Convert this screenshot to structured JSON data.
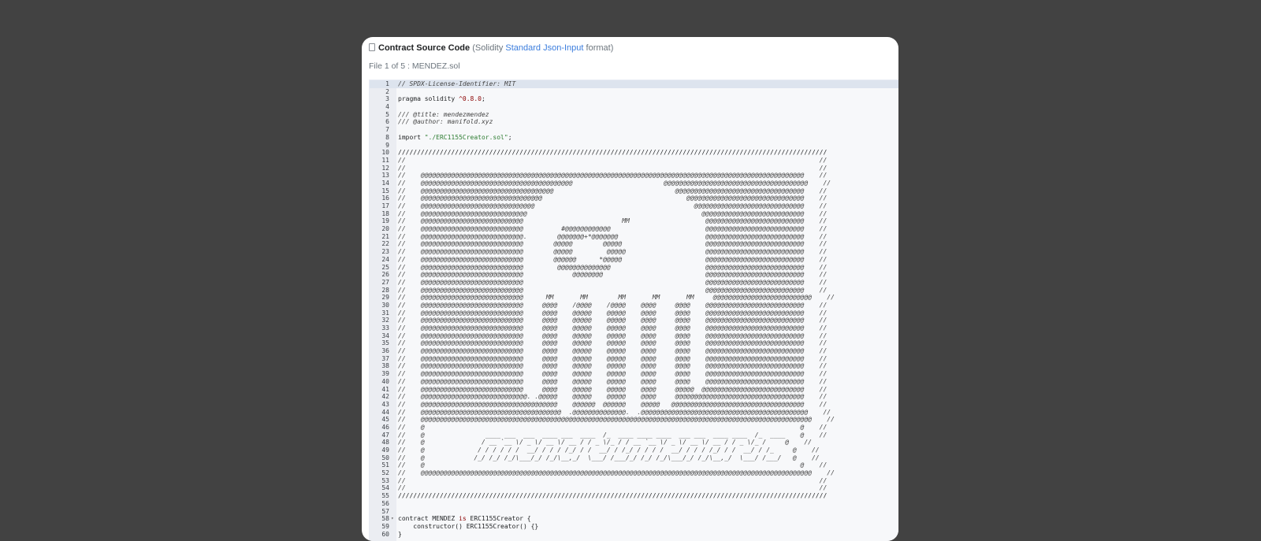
{
  "header": {
    "title": "Contract Source Code",
    "format_open": "(Solidity",
    "format_link": "Standard Json-Input",
    "format_close": "format)"
  },
  "file_info": "File 1 of 5 : MENDEZ.sol",
  "code": {
    "lines": [
      "// SPDX-License-Identifier: MIT",
      "",
      "pragma solidity ^0.8.0;",
      "",
      "/// @title: mendezmendez",
      "/// @author: manifold.xyz",
      "",
      "import \"./ERC1155Creator.sol\";",
      "",
      "/////////////////////////////////////////////////////////////////////////////////////////////////////////////////",
      "//                                                                                                             //",
      "//                                                                                                             //",
      "//    @@@@@@@@@@@@@@@@@@@@@@@@@@@@@@@@@@@@@@@@@@@@@@@@@@@@@@@@@@@@@@@@@@@@@@@@@@@@@@@@@@@@@@@@@@@@@@@@@@@@@    //",
      "//    @@@@@@@@@@@@@@@@@@@@@@@@@@@@@@@@@@@@@@@@                        @@@@@@@@@@@@@@@@@@@@@@@@@@@@@@@@@@@@@@    //",
      "//    @@@@@@@@@@@@@@@@@@@@@@@@@@@@@@@@@@@                                @@@@@@@@@@@@@@@@@@@@@@@@@@@@@@@@@@    //",
      "//    @@@@@@@@@@@@@@@@@@@@@@@@@@@@@@@@                                      @@@@@@@@@@@@@@@@@@@@@@@@@@@@@@@    //",
      "//    @@@@@@@@@@@@@@@@@@@@@@@@@@@@@@                                          @@@@@@@@@@@@@@@@@@@@@@@@@@@@@    //",
      "//    @@@@@@@@@@@@@@@@@@@@@@@@@@@@                                              @@@@@@@@@@@@@@@@@@@@@@@@@@@    //",
      "//    @@@@@@@@@@@@@@@@@@@@@@@@@@@                          MM                    @@@@@@@@@@@@@@@@@@@@@@@@@@    //",
      "//    @@@@@@@@@@@@@@@@@@@@@@@@@@@          #@@@@@@@@@@@@                         @@@@@@@@@@@@@@@@@@@@@@@@@@    //",
      "//    @@@@@@@@@@@@@@@@@@@@@@@@@@@.        @@@@@@@+*@@@@@@@                       @@@@@@@@@@@@@@@@@@@@@@@@@@    //",
      "//    @@@@@@@@@@@@@@@@@@@@@@@@@@@        @@@@@        @@@@@                      @@@@@@@@@@@@@@@@@@@@@@@@@@    //",
      "//    @@@@@@@@@@@@@@@@@@@@@@@@@@@        @@@@@         @@@@@                     @@@@@@@@@@@@@@@@@@@@@@@@@@    //",
      "//    @@@@@@@@@@@@@@@@@@@@@@@@@@@        @@@@@@      *@@@@@                      @@@@@@@@@@@@@@@@@@@@@@@@@@    //",
      "//    @@@@@@@@@@@@@@@@@@@@@@@@@@@         @@@@@@@@@@@@@@                         @@@@@@@@@@@@@@@@@@@@@@@@@@    //",
      "//    @@@@@@@@@@@@@@@@@@@@@@@@@@@             @@@@@@@@                           @@@@@@@@@@@@@@@@@@@@@@@@@@    //",
      "//    @@@@@@@@@@@@@@@@@@@@@@@@@@@                                                @@@@@@@@@@@@@@@@@@@@@@@@@@    //",
      "//    @@@@@@@@@@@@@@@@@@@@@@@@@@@                                                @@@@@@@@@@@@@@@@@@@@@@@@@@    //",
      "//    @@@@@@@@@@@@@@@@@@@@@@@@@@@      MM       MM        MM       MM       MM     @@@@@@@@@@@@@@@@@@@@@@@@@@    //",
      "//    @@@@@@@@@@@@@@@@@@@@@@@@@@@     @@@@    /@@@@    /@@@@    @@@@     @@@@    @@@@@@@@@@@@@@@@@@@@@@@@@@    //",
      "//    @@@@@@@@@@@@@@@@@@@@@@@@@@@     @@@@    @@@@@    @@@@@    @@@@     @@@@    @@@@@@@@@@@@@@@@@@@@@@@@@@    //",
      "//    @@@@@@@@@@@@@@@@@@@@@@@@@@@     @@@@    @@@@@    @@@@@    @@@@     @@@@    @@@@@@@@@@@@@@@@@@@@@@@@@@    //",
      "//    @@@@@@@@@@@@@@@@@@@@@@@@@@@     @@@@    @@@@@    @@@@@    @@@@     @@@@    @@@@@@@@@@@@@@@@@@@@@@@@@@    //",
      "//    @@@@@@@@@@@@@@@@@@@@@@@@@@@     @@@@    @@@@@    @@@@@    @@@@     @@@@    @@@@@@@@@@@@@@@@@@@@@@@@@@    //",
      "//    @@@@@@@@@@@@@@@@@@@@@@@@@@@     @@@@    @@@@@    @@@@@    @@@@     @@@@    @@@@@@@@@@@@@@@@@@@@@@@@@@    //",
      "//    @@@@@@@@@@@@@@@@@@@@@@@@@@@     @@@@    @@@@@    @@@@@    @@@@     @@@@    @@@@@@@@@@@@@@@@@@@@@@@@@@    //",
      "//    @@@@@@@@@@@@@@@@@@@@@@@@@@@     @@@@    @@@@@    @@@@@    @@@@     @@@@    @@@@@@@@@@@@@@@@@@@@@@@@@@    //",
      "//    @@@@@@@@@@@@@@@@@@@@@@@@@@@     @@@@    @@@@@    @@@@@    @@@@     @@@@    @@@@@@@@@@@@@@@@@@@@@@@@@@    //",
      "//    @@@@@@@@@@@@@@@@@@@@@@@@@@@     @@@@    @@@@@    @@@@@    @@@@     @@@@    @@@@@@@@@@@@@@@@@@@@@@@@@@    //",
      "//    @@@@@@@@@@@@@@@@@@@@@@@@@@@     @@@@    @@@@@    @@@@@    @@@@     @@@@    @@@@@@@@@@@@@@@@@@@@@@@@@@    //",
      "//    @@@@@@@@@@@@@@@@@@@@@@@@@@@     @@@@    @@@@@    @@@@@    @@@@     @@@@@  @@@@@@@@@@@@@@@@@@@@@@@@@@@    //",
      "//    @@@@@@@@@@@@@@@@@@@@@@@@@@@@. .@@@@@    @@@@@    @@@@@    @@@@     @@@@@@@@@@@@@@@@@@@@@@@@@@@@@@@@@@    //",
      "//    @@@@@@@@@@@@@@@@@@@@@@@@@@@@@@@@@@@@    @@@@@@  @@@@@@    @@@@@   @@@@@@@@@@@@@@@@@@@@@@@@@@@@@@@@@@@    //",
      "//    @@@@@@@@@@@@@@@@@@@@@@@@@@@@@@@@@@@@@  .@@@@@@@@@@@@@@.  .@@@@@@@@@@@@@@@@@@@@@@@@@@@@@@@@@@@@@@@@@@@@    //",
      "//    @@@@@@@@@@@@@@@@@@@@@@@@@@@@@@@@@@@@@@@@@@@@@@@@@@@@@@@@@@@@@@@@@@@@@@@@@@@@@@@@@@@@@@@@@@@@@@@@@@@@@@@    //",
      "//    @                                                                                                   @    //",
      "//    @                ____ ___  ___  ____ ___  ____  /_  ____ ____ ____  ___ ___  ____ ____  /_  ____    @    //",
      "//    @               / __ `__ \\/ _ \\/ __ \\/ __ / / _ \\/_ / / __ `__ \\/ _ \\/ __ \\/ __ / / _ \\/_ /     @    //",
      "//    @              / / / / / /  __/ / / / /_/ / /  __/ / /_/ / / / /  __/ / / / /_/ / /  __/ / /_     @    //",
      "//    @             /_/ /_/ /_/\\___/_/ /_/\\__,_/  \\___/ /___/_/ /_/ /_/\\___/_/ /_/\\__,_/  \\___/ /___/   @    //",
      "//    @                                                                                                   @    //",
      "//    @@@@@@@@@@@@@@@@@@@@@@@@@@@@@@@@@@@@@@@@@@@@@@@@@@@@@@@@@@@@@@@@@@@@@@@@@@@@@@@@@@@@@@@@@@@@@@@@@@@@@@@    //",
      "//                                                                                                             //",
      "//                                                                                                             //",
      "/////////////////////////////////////////////////////////////////////////////////////////////////////////////////",
      "",
      "",
      "contract MENDEZ is ERC1155Creator {",
      "    constructor() ERC1155Creator() {}",
      "}"
    ]
  }
}
